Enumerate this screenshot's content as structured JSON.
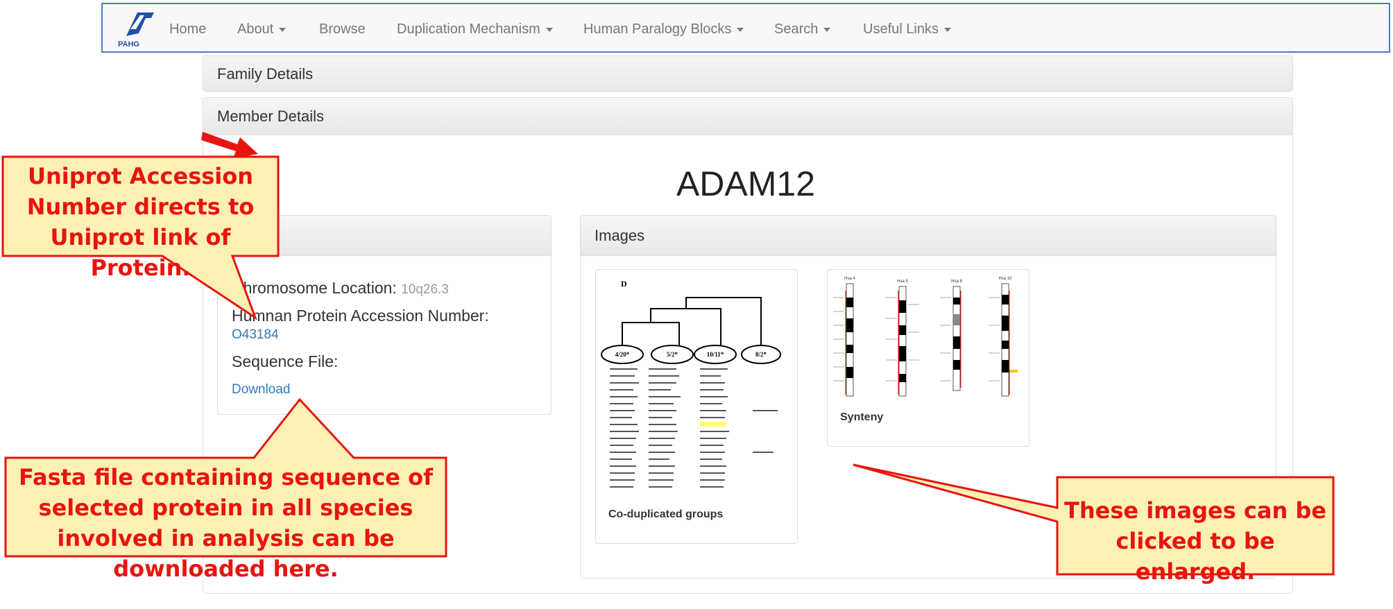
{
  "navbar": {
    "logo_text": "PAHG",
    "items": [
      {
        "label": "Home",
        "dropdown": false
      },
      {
        "label": "About",
        "dropdown": true
      },
      {
        "label": "Browse",
        "dropdown": false
      },
      {
        "label": "Duplication Mechanism",
        "dropdown": true
      },
      {
        "label": "Human Paralogy Blocks",
        "dropdown": true
      },
      {
        "label": "Search",
        "dropdown": true
      },
      {
        "label": "Useful Links",
        "dropdown": true
      }
    ]
  },
  "panels": {
    "family_details": "Family Details",
    "member_details": "Member Details"
  },
  "gene": {
    "name": "ADAM12"
  },
  "info": {
    "chromosome_label": "Chromosome Location:",
    "chromosome_value": "10q26.3",
    "accession_label": "Humnan Protein Accession Number:",
    "accession_value": "O43184",
    "sequence_label": "Sequence File:",
    "download_label": "Download"
  },
  "images": {
    "title": "Images",
    "thumbs": [
      {
        "caption": "Co-duplicated groups",
        "panel_letter": "D",
        "groups": [
          "4/20*",
          "5/2*",
          "10/11*",
          "8/2*"
        ]
      },
      {
        "caption": "Synteny",
        "chromosomes": [
          "Hsa 4",
          "Hsa 5",
          "Hsa 8",
          "Hsa 10"
        ]
      }
    ]
  },
  "callouts": {
    "uniprot": "Uniprot Accession Number directs to Uniprot link of Protein.",
    "fasta": "Fasta file containing sequence of selected protein in all species involved in analysis can be downloaded here.",
    "images": "These images can be clicked to be enlarged."
  },
  "colors": {
    "callout_fill": "#fdf0b5",
    "callout_border": "#e8140f",
    "link": "#337ab7",
    "highlight": "#ffff66"
  }
}
